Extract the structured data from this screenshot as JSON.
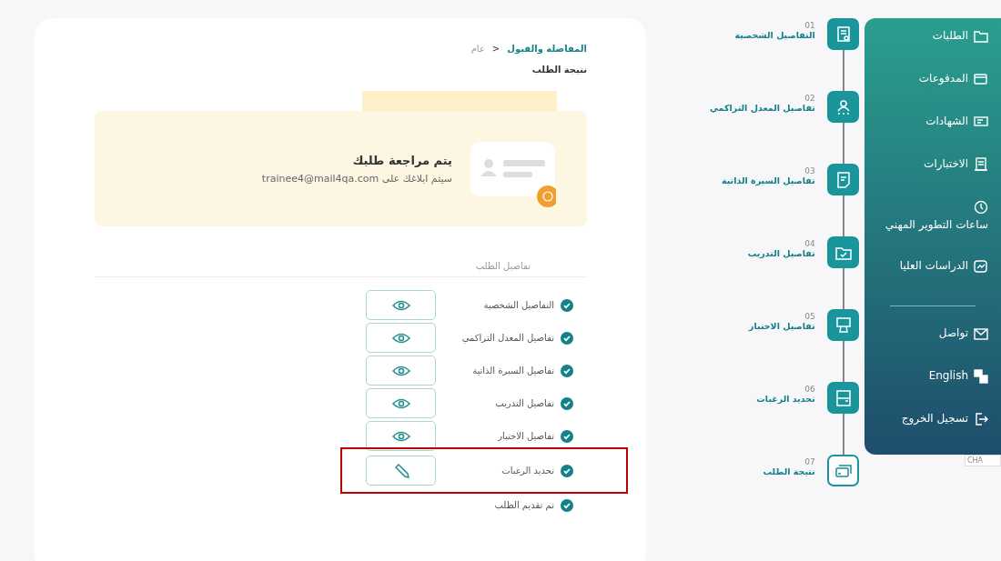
{
  "breadcrumb": {
    "current": "المفاضلة والقبول",
    "separator": "<",
    "parent": "عام"
  },
  "page_title": "نتيجة الطلب",
  "status_banner": {
    "title": "يتم مراجعة طلبك",
    "message": "سيتم ابلاغك على trainee4@mail4qa.com"
  },
  "details": {
    "heading": "تفاصيل الطلب",
    "rows": [
      {
        "label": "التفاصيل الشخصية",
        "kind": "view",
        "highlighted": false
      },
      {
        "label": "تفاصيل المعدل التراكمي",
        "kind": "view",
        "highlighted": false
      },
      {
        "label": "تفاصيل السيرة الذاتية",
        "kind": "view",
        "highlighted": false
      },
      {
        "label": "تفاصيل التدريب",
        "kind": "view",
        "highlighted": false
      },
      {
        "label": "تفاصيل الاختبار",
        "kind": "view",
        "highlighted": false
      },
      {
        "label": "تحديد الرغبات",
        "kind": "edit",
        "highlighted": true
      },
      {
        "label": "تم تقديم الطلب",
        "kind": "plain",
        "highlighted": false
      }
    ]
  },
  "steps": [
    {
      "number": "01",
      "label": "التفاصيل الشخصية",
      "completed": true
    },
    {
      "number": "02",
      "label": "تفاصيل المعدل التراكمي",
      "completed": true
    },
    {
      "number": "03",
      "label": "تفاصيل السيرة الذاتية",
      "completed": true
    },
    {
      "number": "04",
      "label": "تفاصيل التدريب",
      "completed": true
    },
    {
      "number": "05",
      "label": "تفاصيل الاختبار",
      "completed": true
    },
    {
      "number": "06",
      "label": "تحديد الرغبات",
      "completed": true
    },
    {
      "number": "07",
      "label": "نتيجة الطلب",
      "completed": false
    }
  ],
  "sidebar": {
    "items": [
      {
        "label": "الطلبات",
        "kind": "inline"
      },
      {
        "label": "المدفوعات",
        "kind": "inline"
      },
      {
        "label": "الشهادات",
        "kind": "inline"
      },
      {
        "label": "الاختبارات",
        "kind": "inline"
      },
      {
        "label": "ساعات التطوير المهني",
        "kind": "stacked"
      },
      {
        "label": "الدراسات العليا",
        "kind": "inline"
      }
    ],
    "footer_items": [
      {
        "label": "تواصل"
      },
      {
        "label": "English"
      },
      {
        "label": "تسجيل الخروج"
      }
    ]
  },
  "tooltip_fragment": "CHA"
}
